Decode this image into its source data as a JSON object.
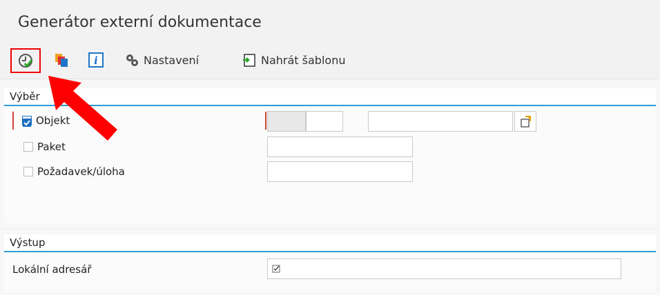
{
  "window": {
    "title": "Generátor externí dokumentace"
  },
  "toolbar": {
    "execute_icon": "execute-clock-check-icon",
    "layers_icon": "layers-icon",
    "info_icon": "info-icon",
    "settings_label": "Nastavení",
    "upload_label": "Nahrát šablonu"
  },
  "selection": {
    "title": "Výběr",
    "items": [
      {
        "label": "Objekt",
        "checked": true
      },
      {
        "label": "Paket",
        "checked": false
      },
      {
        "label": "Požadavek/úloha",
        "checked": false
      }
    ]
  },
  "output": {
    "title": "Výstup",
    "local_dir_label": "Lokální adresář",
    "local_dir_value": "",
    "local_dir_icon": "checkbox-icon"
  },
  "annotation": {
    "arrow_color": "#ff0000"
  }
}
